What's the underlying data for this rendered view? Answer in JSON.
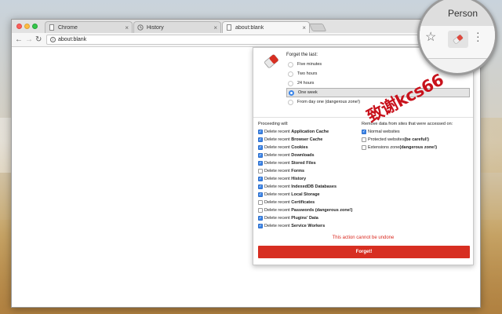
{
  "tabs": [
    {
      "title": "Chrome",
      "icon": "doc-icon",
      "active": false
    },
    {
      "title": "History",
      "icon": "history-icon",
      "active": false
    },
    {
      "title": "about:blank",
      "icon": "doc-icon",
      "active": true
    }
  ],
  "toolbar": {
    "url": "about:blank",
    "info_glyph": "i"
  },
  "zoom": {
    "profile_label": "Person"
  },
  "popup": {
    "forget_title": "Forget the last:",
    "timeframes": [
      {
        "label": "Five minutes",
        "selected": false
      },
      {
        "label": "Two hours",
        "selected": false
      },
      {
        "label": "24 hours",
        "selected": false
      },
      {
        "label": "One week",
        "selected": true
      },
      {
        "label": "From day one (dangerous zone!)",
        "selected": false
      }
    ],
    "proceeding_title": "Proceeding will:",
    "remove_title": "Remove data from sites that were accessed on:",
    "delete_items": [
      {
        "prefix": "Delete recent ",
        "name": "Application Cache",
        "checked": true
      },
      {
        "prefix": "Delete recent ",
        "name": "Browser Cache",
        "checked": true
      },
      {
        "prefix": "Delete recent ",
        "name": "Cookies",
        "checked": true
      },
      {
        "prefix": "Delete recent ",
        "name": "Downloads",
        "checked": true
      },
      {
        "prefix": "Delete recent ",
        "name": "Stored Files",
        "checked": true
      },
      {
        "prefix": "Delete recent ",
        "name": "Forms",
        "checked": false
      },
      {
        "prefix": "Delete recent ",
        "name": "History",
        "checked": true
      },
      {
        "prefix": "Delete recent ",
        "name": "IndexedDB Databases",
        "checked": true
      },
      {
        "prefix": "Delete recent ",
        "name": "Local Storage",
        "checked": true
      },
      {
        "prefix": "Delete recent ",
        "name": "Certificates",
        "checked": false
      },
      {
        "prefix": "Delete recent ",
        "name": "Passwords (dangerous zone!)",
        "checked": false
      },
      {
        "prefix": "Delete recent ",
        "name": "Plugins' Data",
        "checked": true
      },
      {
        "prefix": "Delete recent ",
        "name": "Service Workers",
        "checked": true
      }
    ],
    "site_types": [
      {
        "prefix": "Normal websites",
        "bold": "",
        "checked": true
      },
      {
        "prefix": "Protected websites ",
        "bold": "(be careful!)",
        "checked": false
      },
      {
        "prefix": "Extensions zone ",
        "bold": "(dangerous zone!)",
        "checked": false
      }
    ],
    "warning": "This action cannot be undone",
    "forget_button": "Forget!"
  },
  "watermark": "致谢kcs66",
  "colors": {
    "accent": "#3b85e8",
    "danger": "#d72e21",
    "watermark": "#c8121c"
  }
}
